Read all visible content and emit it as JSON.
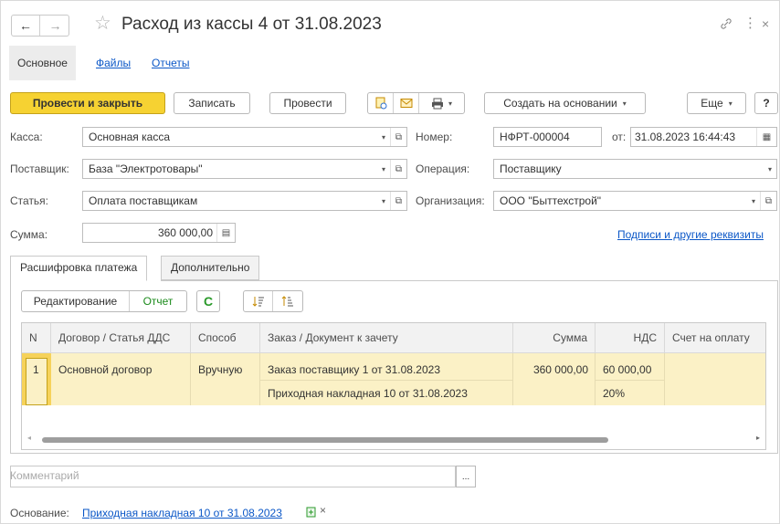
{
  "window": {
    "title": "Расход из кассы 4 от 31.08.2023",
    "back_icon": "←",
    "forward_icon": "→",
    "star_icon": "☆",
    "link_icon": "🔗",
    "more_icon": "⋮",
    "close_icon": "×"
  },
  "top_tabs": [
    {
      "label": "Основное"
    },
    {
      "label": "Файлы"
    },
    {
      "label": "Отчеты"
    }
  ],
  "toolbar": {
    "post_close": "Провести и закрыть",
    "save": "Записать",
    "post": "Провести",
    "create_based": "Создать на основании",
    "more": "Еще",
    "help": "?",
    "dropdown_glyph": "▾"
  },
  "form": {
    "kassa_label": "Касса:",
    "kassa_value": "Основная касса",
    "nomer_label": "Номер:",
    "nomer_value": "НФРТ-000004",
    "ot_label": "от:",
    "date_value": "31.08.2023 16:44:43",
    "supplier_label": "Поставщик:",
    "supplier_value": "База \"Электротовары\"",
    "operation_label": "Операция:",
    "operation_value": "Поставщику",
    "article_label": "Статья:",
    "article_value": "Оплата поставщикам",
    "org_label": "Организация:",
    "org_value": "ООО \"Быттехстрой\"",
    "sum_label": "Сумма:",
    "sum_value": "360 000,00",
    "signatures_link": "Подписи и другие реквизиты"
  },
  "inner_tabs": [
    {
      "label": "Расшифровка платежа"
    },
    {
      "label": "Дополнительно"
    }
  ],
  "table_toolbar": {
    "edit_label": "Редактирование",
    "report_label": "Отчет",
    "refresh_icon": "C"
  },
  "table": {
    "columns": [
      "N",
      "Договор / Статья ДДС",
      "Способ",
      "Заказ / Документ к зачету",
      "Сумма",
      "НДС",
      "Счет на оплату"
    ],
    "rows": [
      {
        "n": "1",
        "contract": "Основной договор",
        "method": "Вручную",
        "order": "Заказ поставщику 1 от 31.08.2023",
        "document": "Приходная накладная 10 от 31.08.2023",
        "sum": "360 000,00",
        "vat": "60 000,00",
        "vat_rate": "20%",
        "invoice": ""
      }
    ]
  },
  "comment_placeholder": "Комментарий",
  "comment_button": "...",
  "basis": {
    "label": "Основание:",
    "link": "Приходная накладная 10 от 31.08.2023",
    "close": "×"
  }
}
